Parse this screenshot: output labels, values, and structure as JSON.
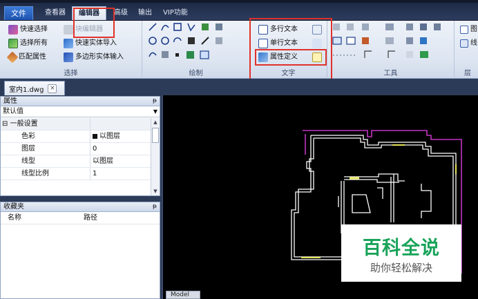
{
  "tabs": [
    "文件",
    "查看器",
    "编辑器",
    "高级",
    "输出",
    "VIP功能"
  ],
  "ribbon": {
    "select_group": {
      "label": "选择",
      "items": [
        "快速选择",
        "选择所有",
        "匹配属性",
        "块编辑器",
        "快速实体导入",
        "多边形实体输入"
      ]
    },
    "draw_group": {
      "label": "绘制"
    },
    "text_group": {
      "label": "文字",
      "items": [
        "多行文本",
        "单行文本",
        "属性定义"
      ]
    },
    "tools_group": {
      "label": "工具"
    },
    "right_group_partial": [
      "图",
      "线",
      "层"
    ]
  },
  "document_tab": {
    "name": "室内1.dwg",
    "close": "×"
  },
  "properties_panel": {
    "title": "属性",
    "pin": "ᵽ",
    "combo_value": "默认值",
    "category": "一般设置",
    "category_toggle": "⊟",
    "rows": [
      {
        "key": "色彩",
        "value": "以图层"
      },
      {
        "key": "图层",
        "value": "0"
      },
      {
        "key": "线型",
        "value": "以图层"
      },
      {
        "key": "线型比例",
        "value": "1"
      }
    ]
  },
  "favorites_panel": {
    "title": "收藏夹",
    "pin": "ᵽ",
    "columns": [
      "名称",
      "路径"
    ]
  },
  "model_tab": "Model",
  "watermark": {
    "title": "百科全说",
    "subtitle": "助你轻松解决"
  },
  "colors": {
    "accent_red": "#e0312a",
    "cad_magenta": "#c234c2",
    "cad_white": "#ffffff",
    "cad_yellow": "#e6e35a",
    "watermark_green": "#19a35a"
  },
  "icons": {
    "quick_select": "quick-select-icon",
    "select_all": "select-all-icon",
    "match_props": "match-properties-icon",
    "block_editor": "block-editor-icon",
    "mtext": "multiline-text-icon",
    "stext": "single-line-text-icon",
    "attdef": "attribute-definition-icon"
  }
}
